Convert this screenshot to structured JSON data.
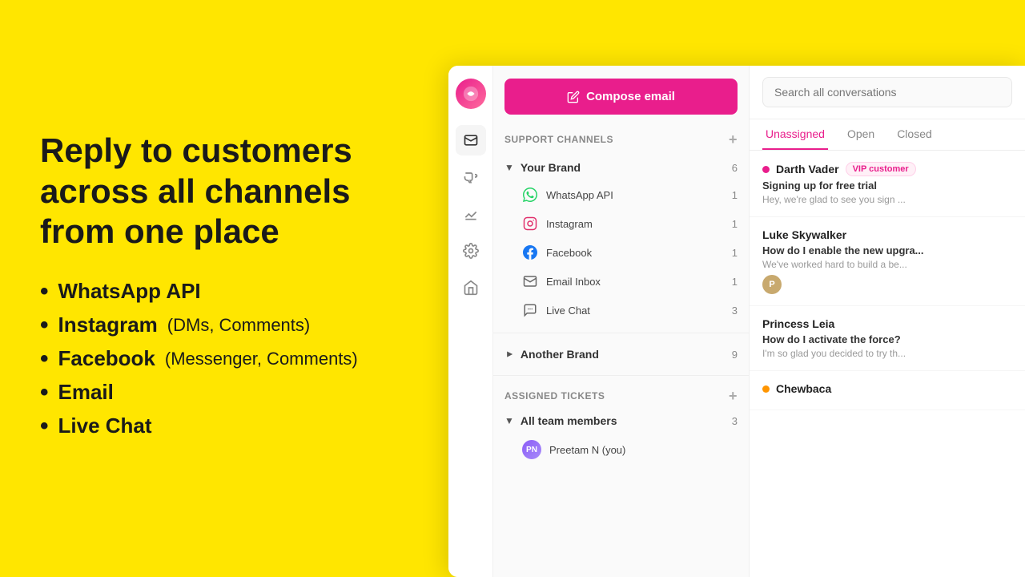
{
  "left": {
    "title_line1": "Reply to customers",
    "title_line2": "across all channels",
    "title_line3": "from one place",
    "features": [
      {
        "main": "WhatsApp API",
        "sub": ""
      },
      {
        "main": "Instagram",
        "sub": " (DMs, Comments)"
      },
      {
        "main": "Facebook",
        "sub": " (Messenger, Comments)"
      },
      {
        "main": "Email",
        "sub": ""
      },
      {
        "main": "Live Chat",
        "sub": ""
      }
    ]
  },
  "app": {
    "compose_btn": "Compose email",
    "support_channels_label": "Support channels",
    "brands": [
      {
        "name": "Your Brand",
        "count": 6,
        "expanded": true,
        "channels": [
          {
            "name": "WhatsApp API",
            "count": 1,
            "icon": "whatsapp"
          },
          {
            "name": "Instagram",
            "count": 1,
            "icon": "instagram"
          },
          {
            "name": "Facebook",
            "count": 1,
            "icon": "facebook"
          },
          {
            "name": "Email Inbox",
            "count": 1,
            "icon": "email"
          },
          {
            "name": "Live Chat",
            "count": 3,
            "icon": "chat"
          }
        ]
      },
      {
        "name": "Another Brand",
        "count": 9,
        "expanded": false,
        "channels": []
      }
    ],
    "assigned_label": "Assigned tickets",
    "all_team": {
      "name": "All team members",
      "count": 3
    },
    "members": [
      {
        "initials": "PN",
        "name": "Preetam N (you)",
        "count": ""
      }
    ],
    "search_placeholder": "Search all conversations",
    "tabs": [
      "Unassigned",
      "Open",
      "Closed"
    ],
    "active_tab": "Unassigned",
    "conversations": [
      {
        "name": "Darth Vader",
        "vip": true,
        "online": true,
        "online_color": "pink",
        "subject": "Signing up for free trial",
        "preview": "Hey, we're glad to see you sign ...",
        "avatar": null
      },
      {
        "name": "Luke Skywalker",
        "vip": false,
        "online": false,
        "subject": "How do I enable the new upgra...",
        "preview": "We've worked hard to build a be...",
        "avatar": "P",
        "avatar_color": "#c8a96e"
      },
      {
        "name": "Princess Leia",
        "vip": false,
        "online": false,
        "subject": "How do I activate the force?",
        "preview": "I'm so glad you decided to try th...",
        "avatar": null
      },
      {
        "name": "Chewbaca",
        "vip": false,
        "online": true,
        "online_color": "orange",
        "subject": "",
        "preview": "",
        "avatar": null
      }
    ]
  },
  "colors": {
    "brand_pink": "#e91e8c",
    "yellow_bg": "#FFE600"
  }
}
